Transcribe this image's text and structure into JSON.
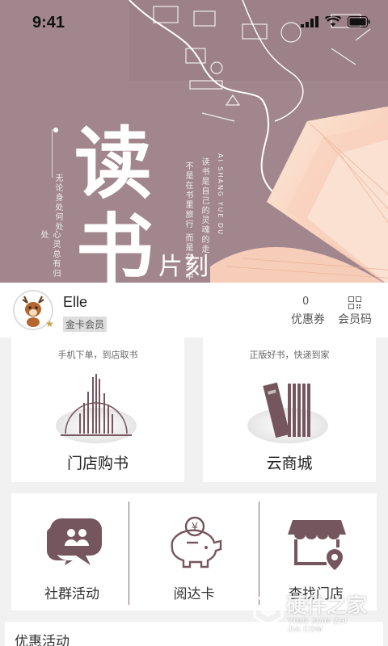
{
  "status_bar": {
    "time": "9:41"
  },
  "hero": {
    "title_line1": "读",
    "title_line2": "书",
    "subtitle": "片刻",
    "vertical_text": [
      "无论身处何处",
      "心灵总有归处",
      "读书是自己的灵魂的走",
      "不是在书里旅行 而是在书中",
      "AI SHANG YUE DU"
    ],
    "colors": {
      "background": "#a1878d"
    }
  },
  "profile": {
    "name": "Elle",
    "member_level": "金卡会员",
    "coupon_count": "0",
    "coupon_label": "优惠券",
    "member_code_label": "会员码"
  },
  "cards": [
    {
      "subtitle": "手机下单，到店取书",
      "title": "门店购书",
      "icon": "building-icon"
    },
    {
      "subtitle": "正版好书，快递到家",
      "title": "云商城",
      "icon": "books-icon"
    }
  ],
  "features": [
    {
      "label": "社群活动",
      "icon": "community-chat-icon"
    },
    {
      "label": "阅达卡",
      "icon": "piggy-bank-icon"
    },
    {
      "label": "查找门店",
      "icon": "store-location-icon"
    }
  ],
  "promo": {
    "title": "优惠活动"
  },
  "watermark": {
    "text": "硬件之家",
    "sub": "YING JIAN ZHI JIA.COM"
  },
  "colors": {
    "accent": "#75565e",
    "page_bg": "#f1f1f1"
  }
}
